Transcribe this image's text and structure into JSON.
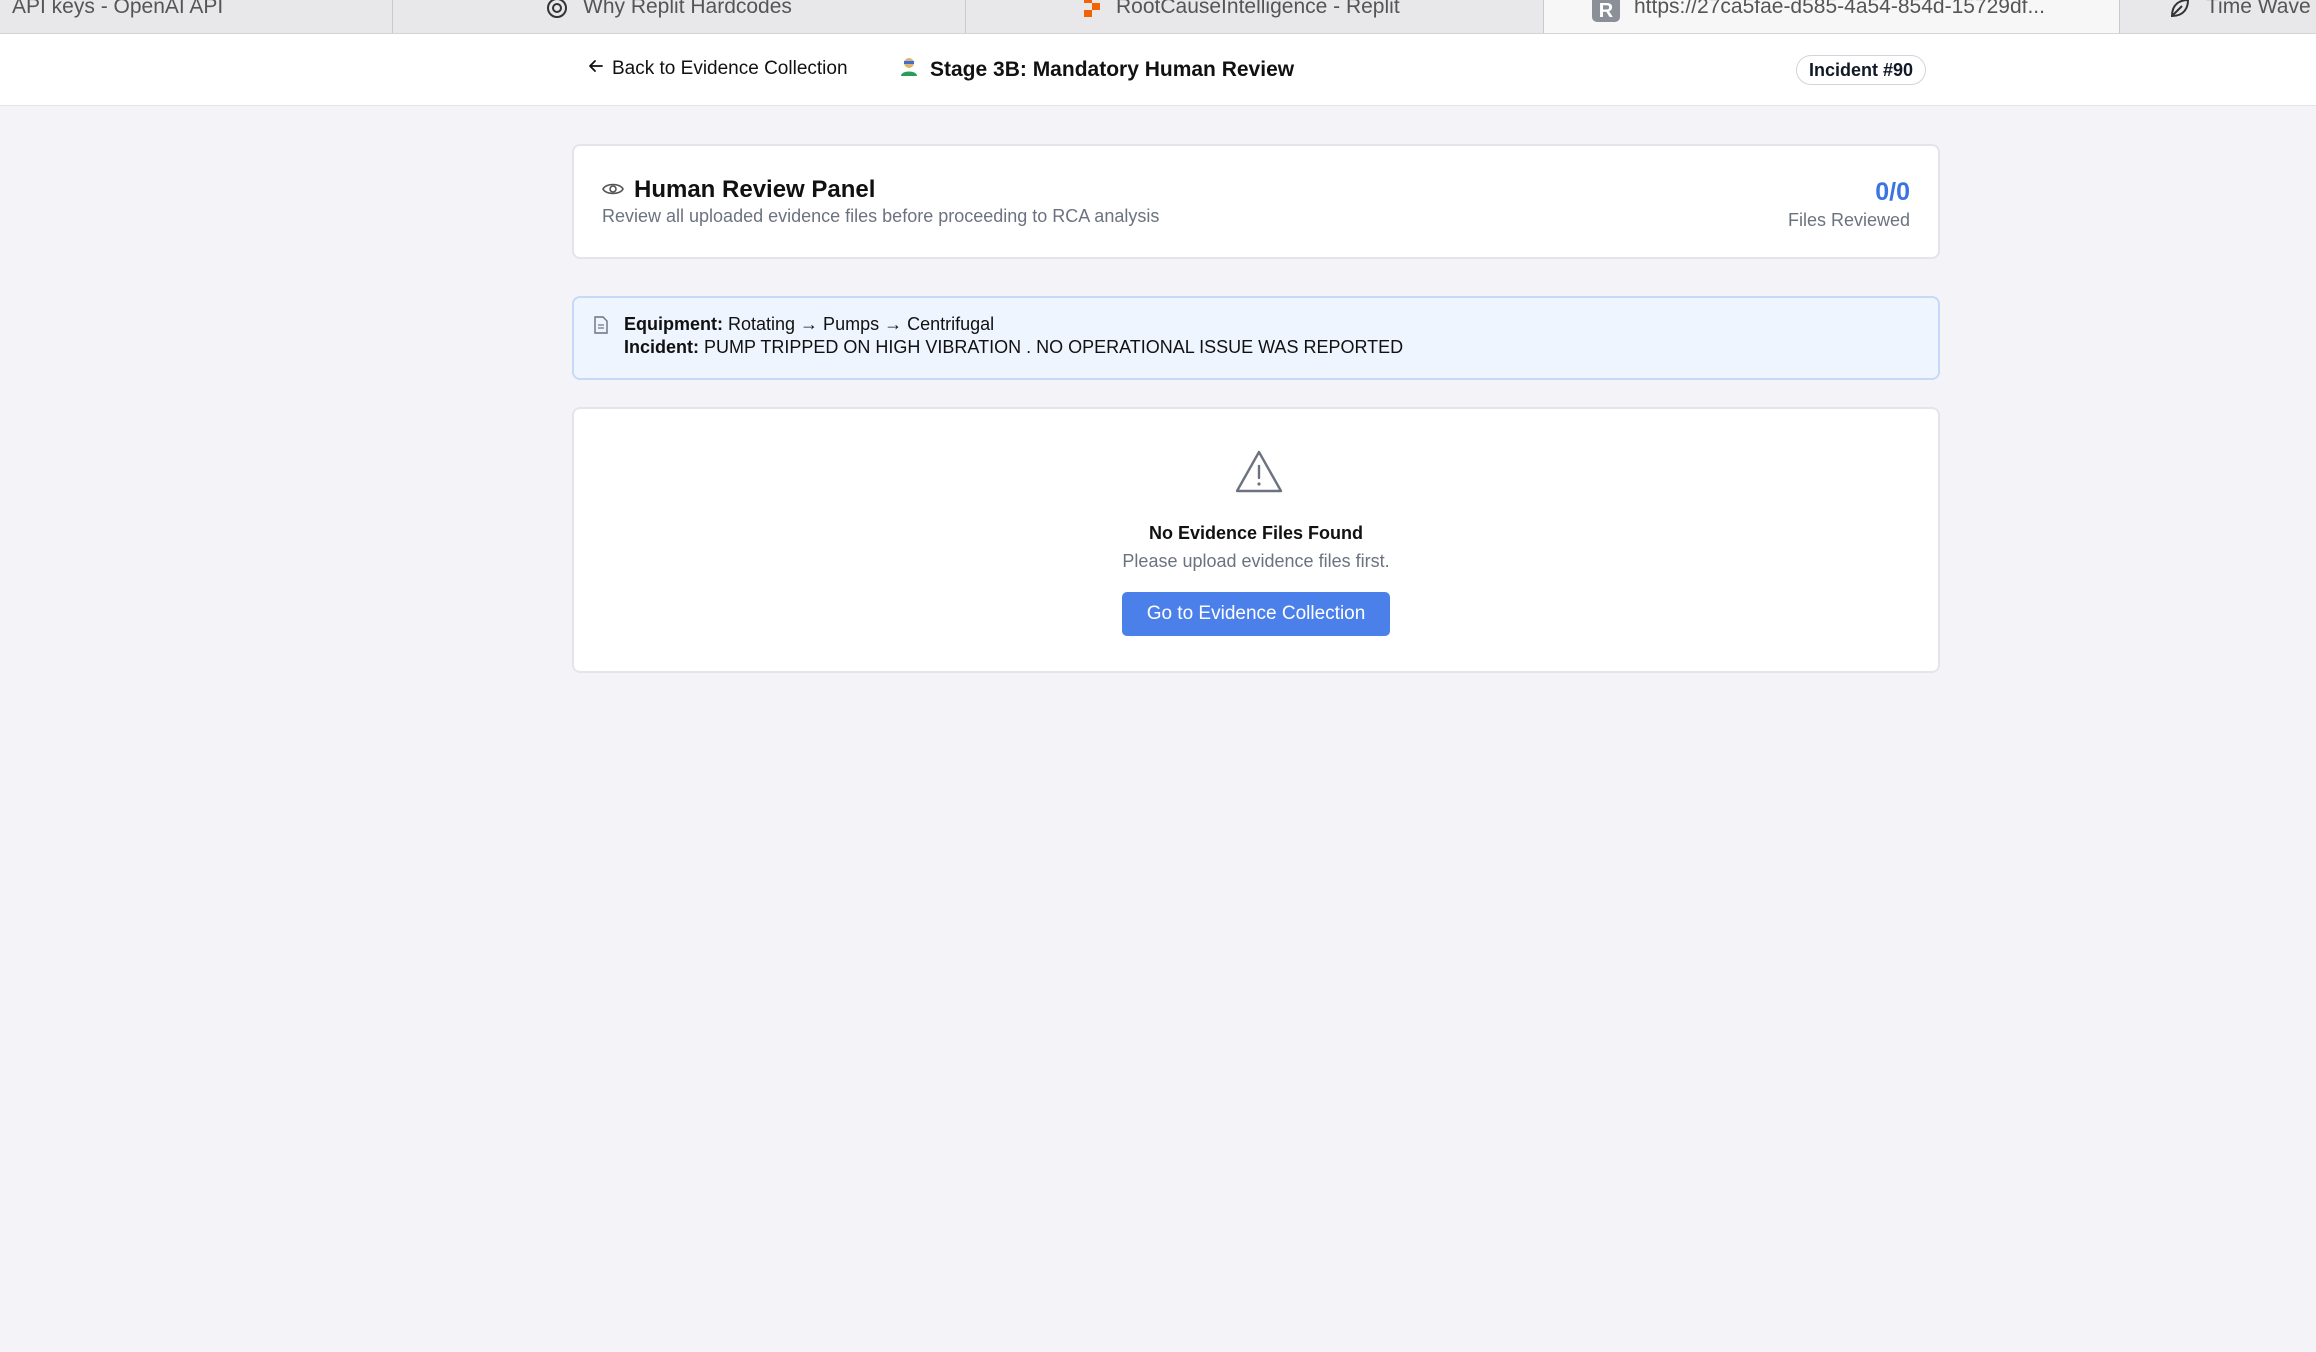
{
  "browser": {
    "tabs": [
      {
        "label": "API keys - OpenAI API",
        "icon": "none"
      },
      {
        "label": "Why Replit Hardcodes",
        "icon": "openai-icon"
      },
      {
        "label": "RootCauseIntelligence - Replit",
        "icon": "replit-icon"
      },
      {
        "label": "https://27ca5fae-d585-4a54-854d-15729df...",
        "icon": "r-icon"
      },
      {
        "label": "Time Wave",
        "icon": "leaf-icon"
      }
    ]
  },
  "header": {
    "back_label": "Back to Evidence Collection",
    "stage_title": "Stage 3B: Mandatory Human Review",
    "incident_badge": "Incident #90"
  },
  "review_panel": {
    "title": "Human Review Panel",
    "subtitle": "Review all uploaded evidence files before proceeding to RCA analysis",
    "count": "0/0",
    "count_label": "Files Reviewed"
  },
  "info": {
    "equipment_label": "Equipment:",
    "equipment_value": "Rotating → Pumps → Centrifugal",
    "incident_label": "Incident:",
    "incident_value": "PUMP TRIPPED ON HIGH VIBRATION . NO OPERATIONAL ISSUE WAS REPORTED"
  },
  "empty_state": {
    "title": "No Evidence Files Found",
    "subtitle": "Please upload evidence files first.",
    "button_label": "Go to Evidence Collection"
  },
  "colors": {
    "accent": "#4b80ea",
    "count": "#3b74e0",
    "page_bg": "#f4f4f8",
    "info_bg": "#eef5ff"
  }
}
